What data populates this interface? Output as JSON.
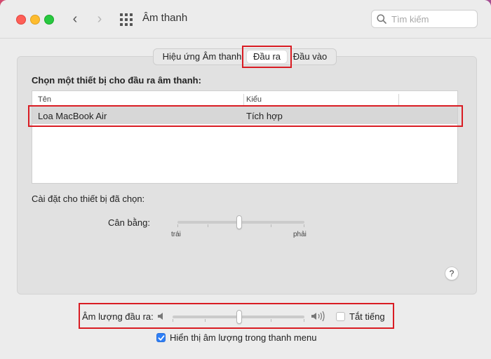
{
  "window": {
    "title": "Âm thanh",
    "search_placeholder": "Tìm kiếm"
  },
  "tabs": [
    {
      "label": "Hiệu ứng Âm thanh",
      "selected": false
    },
    {
      "label": "Đầu ra",
      "selected": true
    },
    {
      "label": "Đầu vào",
      "selected": false
    }
  ],
  "output": {
    "section_title": "Chọn một thiết bị cho đầu ra âm thanh:",
    "columns": [
      "Tên",
      "Kiểu"
    ],
    "devices": [
      {
        "name": "Loa MacBook Air",
        "type": "Tích hợp",
        "selected": true
      }
    ],
    "settings_title": "Cài đặt cho thiết bị đã chọn:",
    "balance": {
      "label": "Cân bằng:",
      "left_label": "trái",
      "right_label": "phải",
      "value": 0.5
    }
  },
  "help": {
    "label": "?"
  },
  "volume": {
    "label": "Âm lượng đầu ra:",
    "value": 0.5,
    "mute_label": "Tắt tiếng",
    "muted": false,
    "show_in_menu_label": "Hiển thị âm lượng trong thanh menu",
    "show_in_menu": true
  },
  "colors": {
    "highlight": "#d91c23",
    "checkbox_accent": "#2f7ff6"
  }
}
